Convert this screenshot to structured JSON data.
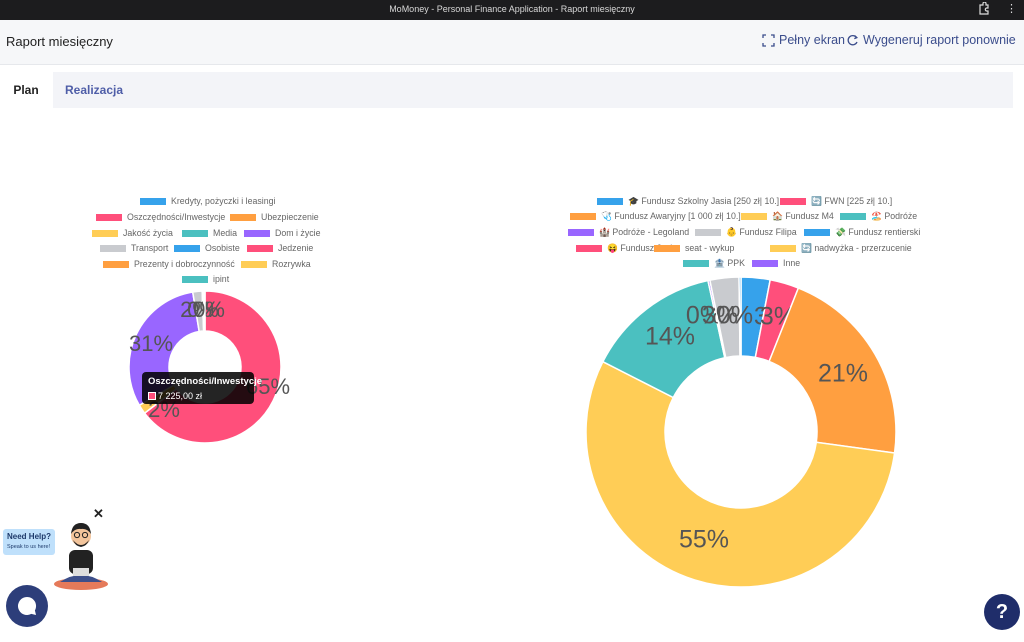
{
  "window": {
    "title": "MoMoney - Personal Finance Application - Raport miesięczny"
  },
  "header": {
    "title": "Raport miesięczny",
    "fullscreen_label": "Pełny ekran",
    "regenerate_label": "Wygeneruj raport ponownie"
  },
  "tabs": [
    {
      "label": "Plan",
      "active": true
    },
    {
      "label": "Realizacja",
      "active": false
    }
  ],
  "chart_data": [
    {
      "type": "pie",
      "legend": [
        {
          "label": "Kredyty, pożyczki i leasingi",
          "color": "#36a2eb"
        },
        {
          "label": "Oszczędności/Inwestycje",
          "color": "#ff4f7b"
        },
        {
          "label": "Ubezpieczenie",
          "color": "#ff9f40"
        },
        {
          "label": "Jakość życia",
          "color": "#ffcd56"
        },
        {
          "label": "Media",
          "color": "#4bc0c0"
        },
        {
          "label": "Dom i życie",
          "color": "#9966ff"
        },
        {
          "label": "Transport",
          "color": "#c9cbcf"
        },
        {
          "label": "Osobiste",
          "color": "#36a2eb"
        },
        {
          "label": "Jedzenie",
          "color": "#ff4f7b"
        },
        {
          "label": "Prezenty i dobroczynność",
          "color": "#ff9f40"
        },
        {
          "label": "Rozrywka",
          "color": "#ffcd56"
        },
        {
          "label": "ipint",
          "color": "#4bc0c0"
        }
      ],
      "slices": [
        {
          "label": "Oszczędności/Inwestycje",
          "value": 65,
          "color": "#ff4f7b",
          "pct_label": "65%"
        },
        {
          "label": "Jakość życia",
          "value": 2,
          "color": "#ffcd56",
          "pct_label": "2%"
        },
        {
          "label": "Dom i życie",
          "value": 31,
          "color": "#9966ff",
          "pct_label": "31%"
        },
        {
          "label": "Transport",
          "value": 2,
          "color": "#c9cbcf",
          "pct_label": "2%"
        },
        {
          "label": "Osobiste",
          "value": 0.3,
          "color": "#36a2eb",
          "pct_label": "0%"
        },
        {
          "label": "Jedzenie",
          "value": 0.3,
          "color": "#ff4f7b",
          "pct_label": "0%"
        }
      ],
      "tooltip": {
        "title": "Oszczędności/Inwestycje",
        "value": "7 225,00 zł"
      }
    },
    {
      "type": "pie",
      "legend": [
        {
          "label": "🎓 Fundusz Szkolny Jasia [250 zł| 10.]",
          "color": "#36a2eb"
        },
        {
          "label": "🔄 FWN [225 zł| 10.]",
          "color": "#ff4f7b"
        },
        {
          "label": "🩺 Fundusz Awaryjny [1 000 zł| 10.]",
          "color": "#ff9f40"
        },
        {
          "label": "🏠 Fundusz M4",
          "color": "#ffcd56"
        },
        {
          "label": "🏖️ Podróże",
          "color": "#4bc0c0"
        },
        {
          "label": "🏰 Podróże - Legoland",
          "color": "#9966ff"
        },
        {
          "label": "👶 Fundusz Filipa",
          "color": "#c9cbcf"
        },
        {
          "label": "💸 Fundusz rentierski",
          "color": "#36a2eb"
        },
        {
          "label": "😝 Fundusz Jasia",
          "color": "#ff4f7b"
        },
        {
          "label": "seat - wykup",
          "color": "#ff9f40"
        },
        {
          "label": "🔄 nadwyżka - przerzucenie",
          "color": "#ffcd56"
        },
        {
          "label": "🏦 PPK",
          "color": "#4bc0c0"
        },
        {
          "label": "Inne",
          "color": "#9966ff"
        }
      ],
      "slices": [
        {
          "label": "Fundusz Szkolny Jasia",
          "value": 3,
          "color": "#36a2eb",
          "pct_label": "3%"
        },
        {
          "label": "FWN",
          "value": 3,
          "color": "#ff4f7b",
          "pct_label": "3%"
        },
        {
          "label": "Fundusz Awaryjny",
          "value": 21,
          "color": "#ff9f40",
          "pct_label": "21%"
        },
        {
          "label": "Fundusz M4",
          "value": 55,
          "color": "#ffcd56",
          "pct_label": "55%"
        },
        {
          "label": "Podróże",
          "value": 14,
          "color": "#4bc0c0",
          "pct_label": "14%"
        },
        {
          "label": "Podróże - Legoland",
          "value": 0.2,
          "color": "#9966ff",
          "pct_label": "0%"
        },
        {
          "label": "Fundusz Filipa",
          "value": 3,
          "color": "#c9cbcf",
          "pct_label": "3%"
        },
        {
          "label": "Fundusz rentierski",
          "value": 0.2,
          "color": "#36a2eb",
          "pct_label": "0%"
        }
      ]
    }
  ],
  "help_widget": {
    "title": "Need Help?",
    "subtitle": "Speak to us here!",
    "close": "✕"
  },
  "help_button": {
    "label": "?"
  }
}
